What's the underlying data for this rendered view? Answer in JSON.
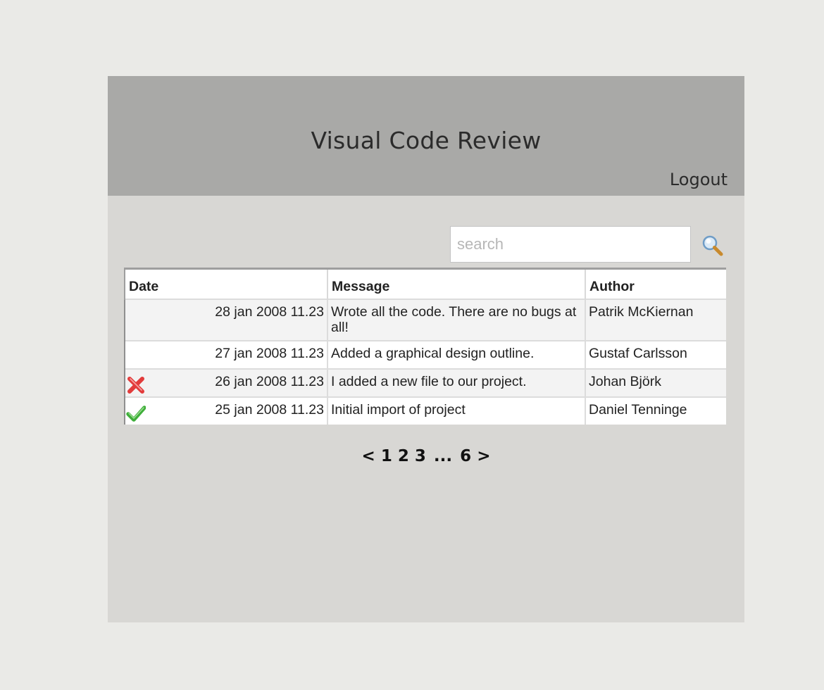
{
  "header": {
    "title": "Visual Code Review",
    "logout_label": "Logout"
  },
  "search": {
    "placeholder": "search",
    "value": "",
    "button_icon": "magnifier-icon"
  },
  "table": {
    "columns": [
      "Date",
      "Message",
      "Author"
    ],
    "rows": [
      {
        "status": "none",
        "date": "28 jan 2008 11.23",
        "message": "Wrote all the code. There are no bugs at all!",
        "author": "Patrik McKiernan"
      },
      {
        "status": "none",
        "date": "27 jan 2008 11.23",
        "message": "Added a graphical design outline.",
        "author": "Gustaf Carlsson"
      },
      {
        "status": "failed",
        "status_icon": "red-x-icon",
        "date": "26 jan 2008 11.23",
        "message": "I added a new file to our project.",
        "author": "Johan Björk"
      },
      {
        "status": "passed",
        "status_icon": "green-check-icon",
        "date": "25 jan 2008 11.23",
        "message": "Initial import of project",
        "author": "Daniel Tenninge"
      }
    ]
  },
  "pagination": {
    "prev": "<",
    "pages": [
      "1",
      "2",
      "3"
    ],
    "ellipsis": "...",
    "last": "6",
    "next": ">"
  },
  "colors": {
    "page_bg": "#eaeae7",
    "panel_bg": "#d8d7d4",
    "header_bg": "#a9a9a7",
    "fail": "#e23b3b",
    "pass": "#3fae3a"
  }
}
